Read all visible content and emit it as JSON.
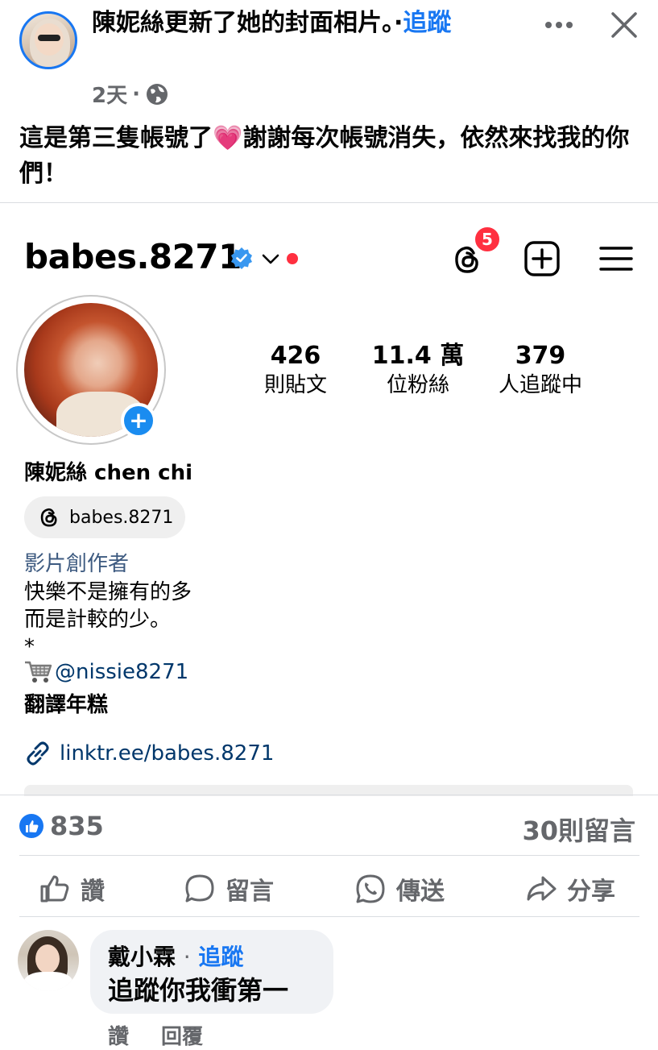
{
  "post": {
    "author": "陳妮絲",
    "title_rest": "更新了她的封面相片。·",
    "follow_label": "追蹤",
    "time": "2天",
    "separator": "·",
    "caption": "這是第三隻帳號了💗謝謝每次帳號消失，依然來找我的你們！"
  },
  "instagram": {
    "username": "babes.8271",
    "threads_badge": "5",
    "stats": [
      {
        "value": "426",
        "label": "則貼文"
      },
      {
        "value": "11.4 萬",
        "label": "位粉絲"
      },
      {
        "value": "379",
        "label": "人追蹤中"
      }
    ],
    "display_name": "陳妮絲 chen chi",
    "threads_handle": "babes.8271",
    "category": "影片創作者",
    "bio": "快樂不是擁有的多\n而是計較的少。\n*",
    "shop_handle": "@nissie8271",
    "bio_last": "翻譯年糕",
    "link": "linktr.ee/babes.8271"
  },
  "reactions": {
    "likes": "835",
    "comments": "30則留言"
  },
  "actions": {
    "like": "讚",
    "comment": "留言",
    "send": "傳送",
    "share": "分享"
  },
  "comment": {
    "author": "戴小霖",
    "dot": "·",
    "follow": "追蹤",
    "text": "追蹤你我衝第一",
    "like": "讚",
    "reply": "回覆"
  },
  "colors": {
    "accent": "#1877f2",
    "ig_link": "#00376b",
    "notification": "#ff3040",
    "muted": "#65676b"
  }
}
